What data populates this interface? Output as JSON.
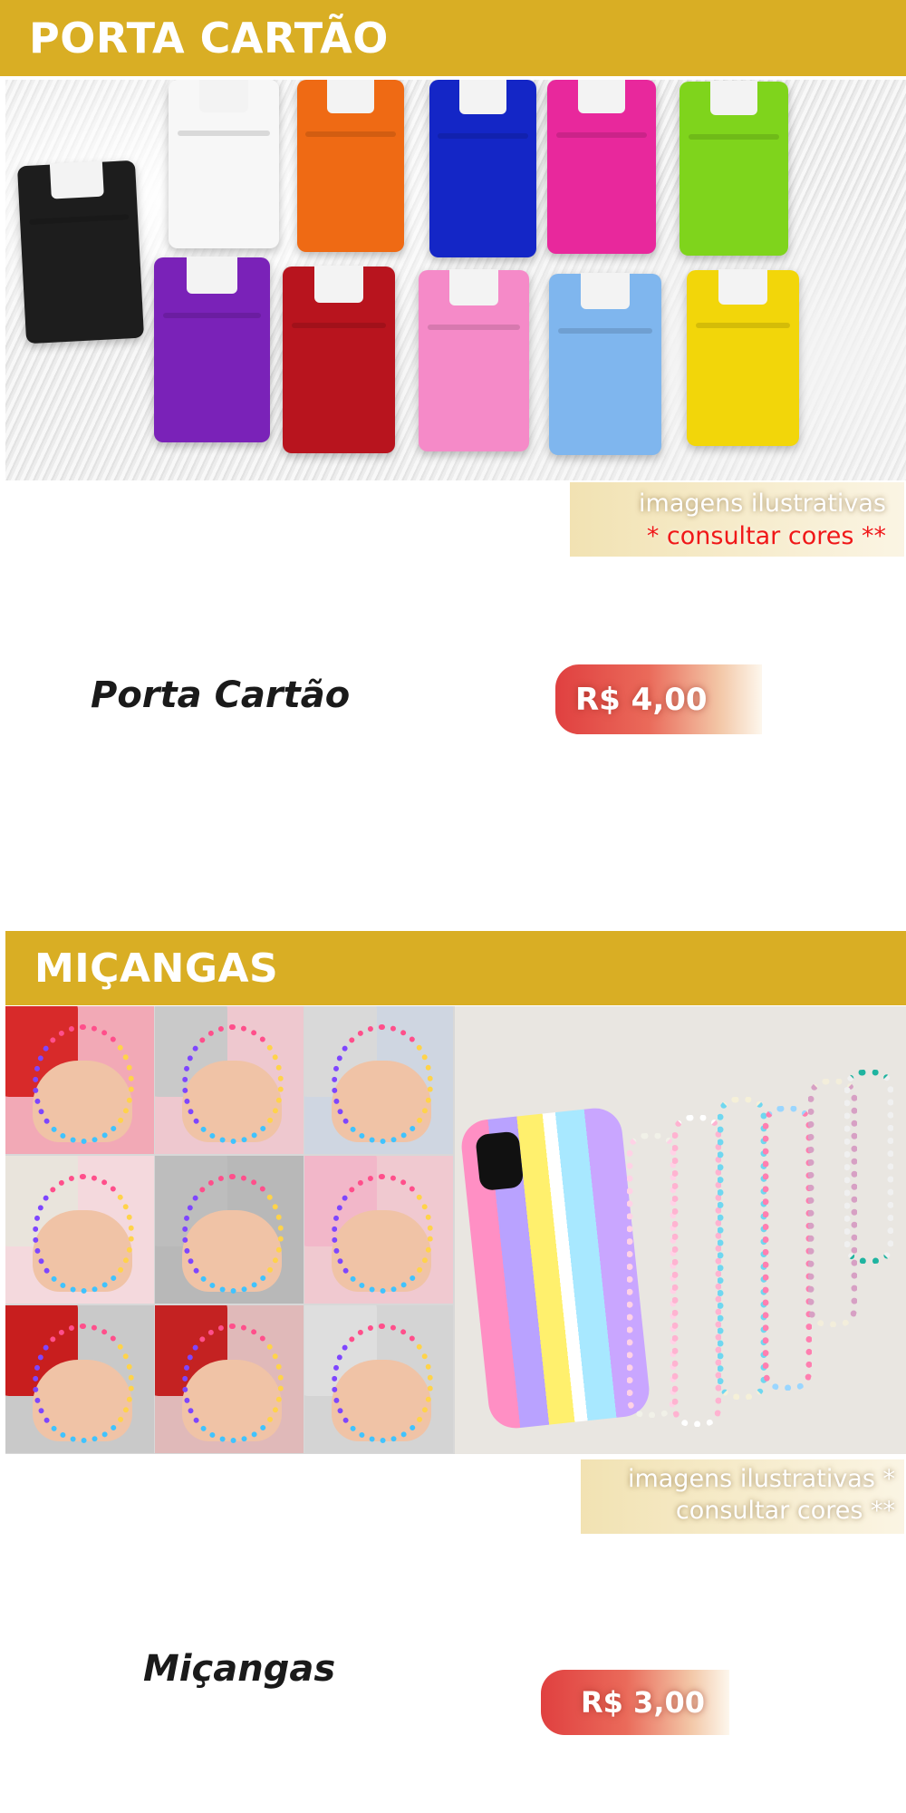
{
  "sections": [
    {
      "heading": "PORTA CARTÃO",
      "caption_line1": "imagens ilustrativas",
      "caption_line2": "* consultar cores **",
      "product_name": "Porta Cartão",
      "price": "R$ 4,00",
      "holder_colors": [
        "#1d1d1d",
        "#f7f7f7",
        "#ef6a14",
        "#1426c6",
        "#e8289c",
        "#7fd41c",
        "#7a22b8",
        "#b8141e",
        "#f58ac8",
        "#7fb6ee",
        "#f2d60a"
      ]
    },
    {
      "heading": "MIÇANGAS",
      "caption_line1": "imagens ilustrativas *",
      "caption_line2": "consultar cores **",
      "product_name": "Miçangas",
      "price": "R$ 3,00"
    }
  ],
  "colors": {
    "banner": "#d9ae24",
    "price_red": "#e04040",
    "caption_red": "#f01818"
  }
}
